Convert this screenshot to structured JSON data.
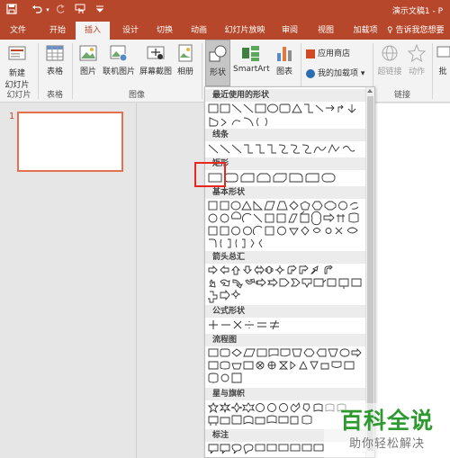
{
  "title_bar": {
    "doc_title": "演示文稿1 - P",
    "quick_icons": [
      "save-icon",
      "undo-icon",
      "redo-icon",
      "touch-mode-icon",
      "customize-icon"
    ]
  },
  "tabs": [
    {
      "label": "文件"
    },
    {
      "label": "开始"
    },
    {
      "label": "插入"
    },
    {
      "label": "设计"
    },
    {
      "label": "切换"
    },
    {
      "label": "动画"
    },
    {
      "label": "幻灯片放映"
    },
    {
      "label": "审阅"
    },
    {
      "label": "视图"
    },
    {
      "label": "加载项"
    }
  ],
  "active_tab": "插入",
  "tell_me": "♀ 告诉我您想要",
  "ribbon": {
    "new_slide": "新建\n幻灯片",
    "new_slide_line1": "新建",
    "new_slide_line2": "幻灯片",
    "table": "表格",
    "pictures": "图片",
    "online_pictures": "联机图片",
    "screenshot": "屏幕截图",
    "album": "相册",
    "shapes": "形状",
    "smartart": "SmartArt",
    "chart": "图表",
    "store": "应用商店",
    "my_addins": "我的加载项",
    "hyperlink": "超链接",
    "action": "动作",
    "comment": "批",
    "groups": {
      "slides": "幻灯片",
      "tables": "表格",
      "images": "图像",
      "links": "链接"
    }
  },
  "slide_number": "1",
  "dropdown": {
    "sections": [
      {
        "title": "最近使用的形状"
      },
      {
        "title": "线条"
      },
      {
        "title": "矩形"
      },
      {
        "title": "基本形状"
      },
      {
        "title": "箭头总汇"
      },
      {
        "title": "公式形状"
      },
      {
        "title": "流程图"
      },
      {
        "title": "星与旗帜"
      },
      {
        "title": "标注"
      }
    ]
  },
  "watermark": {
    "logo": "百科全说",
    "sub": "助你轻松解决"
  },
  "colors": {
    "brand": "#b7472a",
    "highlight": "#e8281e",
    "thumb_border": "#e3704f",
    "watermark": "#2c9a2e"
  }
}
